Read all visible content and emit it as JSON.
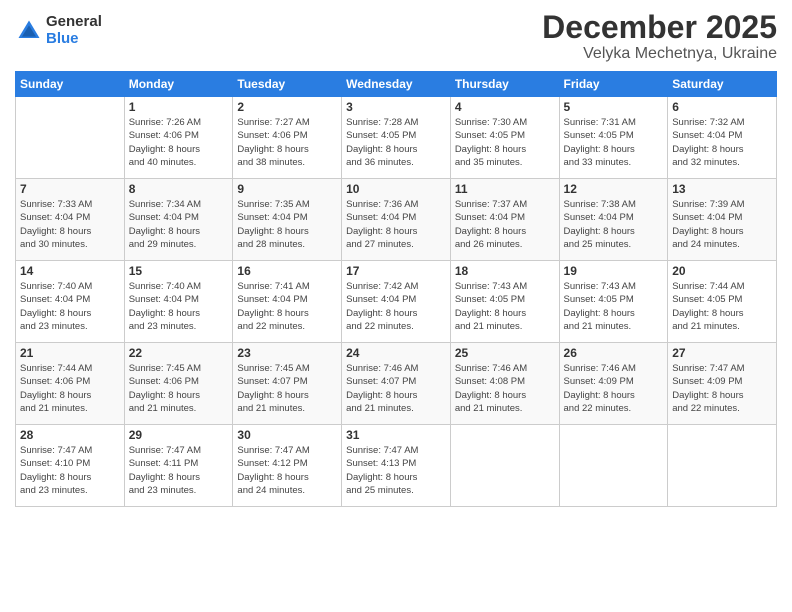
{
  "logo": {
    "general": "General",
    "blue": "Blue"
  },
  "header": {
    "month": "December 2025",
    "location": "Velyka Mechetnya, Ukraine"
  },
  "days_of_week": [
    "Sunday",
    "Monday",
    "Tuesday",
    "Wednesday",
    "Thursday",
    "Friday",
    "Saturday"
  ],
  "weeks": [
    [
      {
        "day": "",
        "sunrise": "",
        "sunset": "",
        "daylight": ""
      },
      {
        "day": "1",
        "sunrise": "Sunrise: 7:26 AM",
        "sunset": "Sunset: 4:06 PM",
        "daylight": "Daylight: 8 hours and 40 minutes."
      },
      {
        "day": "2",
        "sunrise": "Sunrise: 7:27 AM",
        "sunset": "Sunset: 4:06 PM",
        "daylight": "Daylight: 8 hours and 38 minutes."
      },
      {
        "day": "3",
        "sunrise": "Sunrise: 7:28 AM",
        "sunset": "Sunset: 4:05 PM",
        "daylight": "Daylight: 8 hours and 36 minutes."
      },
      {
        "day": "4",
        "sunrise": "Sunrise: 7:30 AM",
        "sunset": "Sunset: 4:05 PM",
        "daylight": "Daylight: 8 hours and 35 minutes."
      },
      {
        "day": "5",
        "sunrise": "Sunrise: 7:31 AM",
        "sunset": "Sunset: 4:05 PM",
        "daylight": "Daylight: 8 hours and 33 minutes."
      },
      {
        "day": "6",
        "sunrise": "Sunrise: 7:32 AM",
        "sunset": "Sunset: 4:04 PM",
        "daylight": "Daylight: 8 hours and 32 minutes."
      }
    ],
    [
      {
        "day": "7",
        "sunrise": "Sunrise: 7:33 AM",
        "sunset": "Sunset: 4:04 PM",
        "daylight": "Daylight: 8 hours and 30 minutes."
      },
      {
        "day": "8",
        "sunrise": "Sunrise: 7:34 AM",
        "sunset": "Sunset: 4:04 PM",
        "daylight": "Daylight: 8 hours and 29 minutes."
      },
      {
        "day": "9",
        "sunrise": "Sunrise: 7:35 AM",
        "sunset": "Sunset: 4:04 PM",
        "daylight": "Daylight: 8 hours and 28 minutes."
      },
      {
        "day": "10",
        "sunrise": "Sunrise: 7:36 AM",
        "sunset": "Sunset: 4:04 PM",
        "daylight": "Daylight: 8 hours and 27 minutes."
      },
      {
        "day": "11",
        "sunrise": "Sunrise: 7:37 AM",
        "sunset": "Sunset: 4:04 PM",
        "daylight": "Daylight: 8 hours and 26 minutes."
      },
      {
        "day": "12",
        "sunrise": "Sunrise: 7:38 AM",
        "sunset": "Sunset: 4:04 PM",
        "daylight": "Daylight: 8 hours and 25 minutes."
      },
      {
        "day": "13",
        "sunrise": "Sunrise: 7:39 AM",
        "sunset": "Sunset: 4:04 PM",
        "daylight": "Daylight: 8 hours and 24 minutes."
      }
    ],
    [
      {
        "day": "14",
        "sunrise": "Sunrise: 7:40 AM",
        "sunset": "Sunset: 4:04 PM",
        "daylight": "Daylight: 8 hours and 23 minutes."
      },
      {
        "day": "15",
        "sunrise": "Sunrise: 7:40 AM",
        "sunset": "Sunset: 4:04 PM",
        "daylight": "Daylight: 8 hours and 23 minutes."
      },
      {
        "day": "16",
        "sunrise": "Sunrise: 7:41 AM",
        "sunset": "Sunset: 4:04 PM",
        "daylight": "Daylight: 8 hours and 22 minutes."
      },
      {
        "day": "17",
        "sunrise": "Sunrise: 7:42 AM",
        "sunset": "Sunset: 4:04 PM",
        "daylight": "Daylight: 8 hours and 22 minutes."
      },
      {
        "day": "18",
        "sunrise": "Sunrise: 7:43 AM",
        "sunset": "Sunset: 4:05 PM",
        "daylight": "Daylight: 8 hours and 21 minutes."
      },
      {
        "day": "19",
        "sunrise": "Sunrise: 7:43 AM",
        "sunset": "Sunset: 4:05 PM",
        "daylight": "Daylight: 8 hours and 21 minutes."
      },
      {
        "day": "20",
        "sunrise": "Sunrise: 7:44 AM",
        "sunset": "Sunset: 4:05 PM",
        "daylight": "Daylight: 8 hours and 21 minutes."
      }
    ],
    [
      {
        "day": "21",
        "sunrise": "Sunrise: 7:44 AM",
        "sunset": "Sunset: 4:06 PM",
        "daylight": "Daylight: 8 hours and 21 minutes."
      },
      {
        "day": "22",
        "sunrise": "Sunrise: 7:45 AM",
        "sunset": "Sunset: 4:06 PM",
        "daylight": "Daylight: 8 hours and 21 minutes."
      },
      {
        "day": "23",
        "sunrise": "Sunrise: 7:45 AM",
        "sunset": "Sunset: 4:07 PM",
        "daylight": "Daylight: 8 hours and 21 minutes."
      },
      {
        "day": "24",
        "sunrise": "Sunrise: 7:46 AM",
        "sunset": "Sunset: 4:07 PM",
        "daylight": "Daylight: 8 hours and 21 minutes."
      },
      {
        "day": "25",
        "sunrise": "Sunrise: 7:46 AM",
        "sunset": "Sunset: 4:08 PM",
        "daylight": "Daylight: 8 hours and 21 minutes."
      },
      {
        "day": "26",
        "sunrise": "Sunrise: 7:46 AM",
        "sunset": "Sunset: 4:09 PM",
        "daylight": "Daylight: 8 hours and 22 minutes."
      },
      {
        "day": "27",
        "sunrise": "Sunrise: 7:47 AM",
        "sunset": "Sunset: 4:09 PM",
        "daylight": "Daylight: 8 hours and 22 minutes."
      }
    ],
    [
      {
        "day": "28",
        "sunrise": "Sunrise: 7:47 AM",
        "sunset": "Sunset: 4:10 PM",
        "daylight": "Daylight: 8 hours and 23 minutes."
      },
      {
        "day": "29",
        "sunrise": "Sunrise: 7:47 AM",
        "sunset": "Sunset: 4:11 PM",
        "daylight": "Daylight: 8 hours and 23 minutes."
      },
      {
        "day": "30",
        "sunrise": "Sunrise: 7:47 AM",
        "sunset": "Sunset: 4:12 PM",
        "daylight": "Daylight: 8 hours and 24 minutes."
      },
      {
        "day": "31",
        "sunrise": "Sunrise: 7:47 AM",
        "sunset": "Sunset: 4:13 PM",
        "daylight": "Daylight: 8 hours and 25 minutes."
      },
      {
        "day": "",
        "sunrise": "",
        "sunset": "",
        "daylight": ""
      },
      {
        "day": "",
        "sunrise": "",
        "sunset": "",
        "daylight": ""
      },
      {
        "day": "",
        "sunrise": "",
        "sunset": "",
        "daylight": ""
      }
    ]
  ]
}
